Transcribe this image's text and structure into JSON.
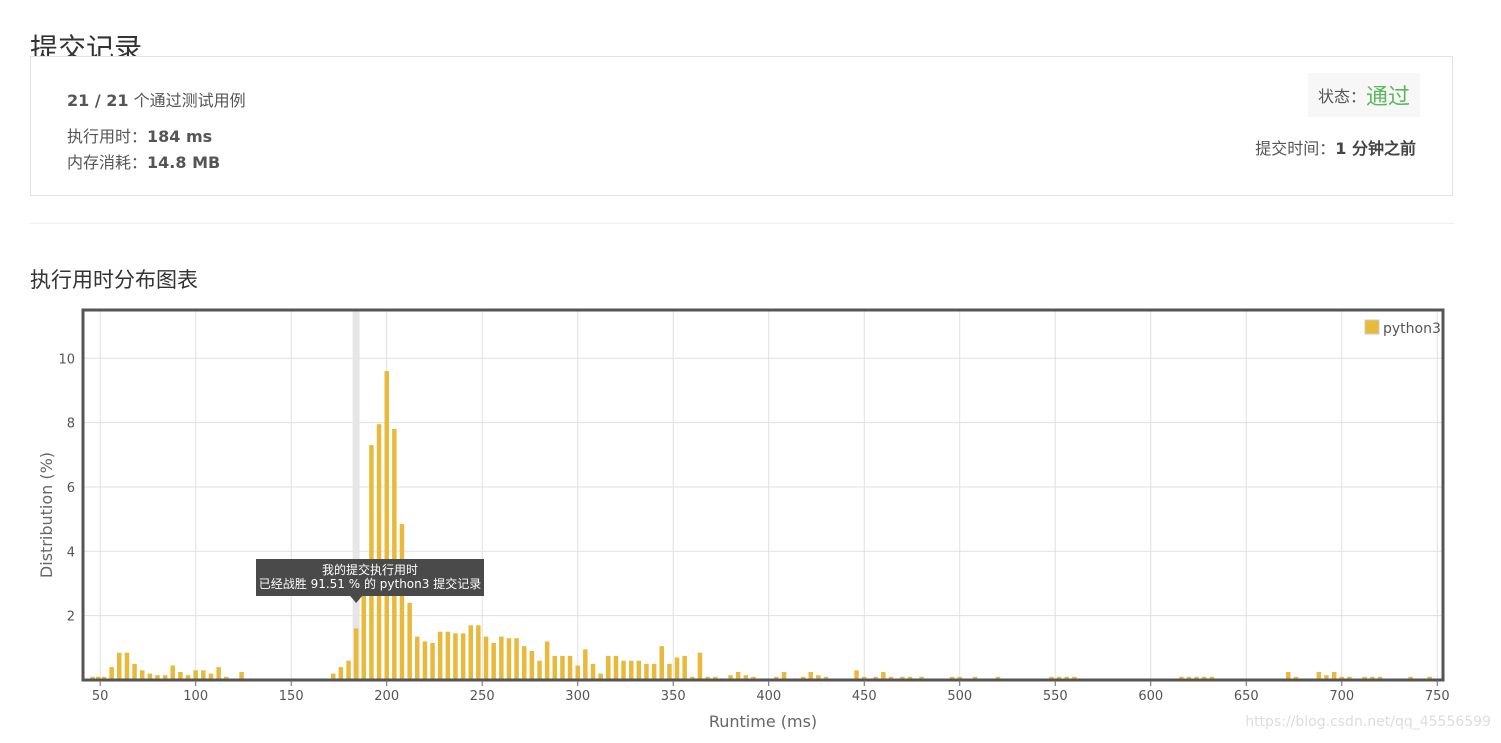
{
  "page": {
    "title": "提交记录"
  },
  "summary": {
    "tests_passed": "21 / 21",
    "tests_suffix": "个通过测试用例",
    "runtime_label": "执行用时：",
    "runtime_value": "184 ms",
    "memory_label": "内存消耗：",
    "memory_value": "14.8 MB",
    "status_label": "状态：",
    "status_value": "通过",
    "status_color": "#5cb85c",
    "submit_time_label": "提交时间：",
    "submit_time_value": "1 分钟之前"
  },
  "chart_section": {
    "title": "执行用时分布图表"
  },
  "chart_data": {
    "type": "bar",
    "xlabel": "Runtime (ms)",
    "ylabel": "Distribution (%)",
    "xlim": [
      41,
      753
    ],
    "ylim": [
      0,
      11.5
    ],
    "xticks": [
      50,
      100,
      150,
      200,
      250,
      300,
      350,
      400,
      450,
      500,
      550,
      600,
      650,
      700,
      750
    ],
    "yticks": [
      2,
      4,
      6,
      8,
      10
    ],
    "grid": true,
    "legend": {
      "position": "top-right"
    },
    "series": [
      {
        "name": "python3",
        "color": "#e8b93a",
        "points": [
          [
            46,
            0.1
          ],
          [
            49,
            0.1
          ],
          [
            52,
            0.1
          ],
          [
            56,
            0.4
          ],
          [
            60,
            0.85
          ],
          [
            64,
            0.85
          ],
          [
            68,
            0.5
          ],
          [
            72,
            0.3
          ],
          [
            76,
            0.2
          ],
          [
            80,
            0.15
          ],
          [
            84,
            0.15
          ],
          [
            88,
            0.45
          ],
          [
            92,
            0.25
          ],
          [
            96,
            0.15
          ],
          [
            100,
            0.3
          ],
          [
            104,
            0.3
          ],
          [
            108,
            0.2
          ],
          [
            112,
            0.4
          ],
          [
            116,
            0.1
          ],
          [
            124,
            0.25
          ],
          [
            172,
            0.2
          ],
          [
            176,
            0.4
          ],
          [
            180,
            0.6
          ],
          [
            184,
            1.6
          ],
          [
            188,
            3.5
          ],
          [
            192,
            7.3
          ],
          [
            196,
            7.95
          ],
          [
            200,
            9.6
          ],
          [
            204,
            7.8
          ],
          [
            208,
            4.85
          ],
          [
            212,
            2.4
          ],
          [
            216,
            1.35
          ],
          [
            220,
            1.2
          ],
          [
            224,
            1.15
          ],
          [
            228,
            1.5
          ],
          [
            232,
            1.5
          ],
          [
            236,
            1.45
          ],
          [
            240,
            1.45
          ],
          [
            244,
            1.7
          ],
          [
            248,
            1.7
          ],
          [
            252,
            1.35
          ],
          [
            256,
            1.15
          ],
          [
            260,
            1.35
          ],
          [
            264,
            1.3
          ],
          [
            268,
            1.3
          ],
          [
            272,
            1.05
          ],
          [
            276,
            0.9
          ],
          [
            280,
            0.6
          ],
          [
            284,
            1.2
          ],
          [
            288,
            0.75
          ],
          [
            292,
            0.75
          ],
          [
            296,
            0.75
          ],
          [
            300,
            0.45
          ],
          [
            304,
            0.95
          ],
          [
            308,
            0.5
          ],
          [
            312,
            0.2
          ],
          [
            316,
            0.75
          ],
          [
            320,
            0.75
          ],
          [
            324,
            0.6
          ],
          [
            328,
            0.6
          ],
          [
            332,
            0.6
          ],
          [
            336,
            0.5
          ],
          [
            340,
            0.5
          ],
          [
            344,
            1.05
          ],
          [
            348,
            0.5
          ],
          [
            352,
            0.7
          ],
          [
            356,
            0.75
          ],
          [
            360,
            0.1
          ],
          [
            364,
            0.85
          ],
          [
            368,
            0.1
          ],
          [
            372,
            0.1
          ],
          [
            376,
            0.05
          ],
          [
            380,
            0.15
          ],
          [
            384,
            0.25
          ],
          [
            388,
            0.15
          ],
          [
            392,
            0.1
          ],
          [
            404,
            0.1
          ],
          [
            408,
            0.25
          ],
          [
            418,
            0.1
          ],
          [
            422,
            0.25
          ],
          [
            426,
            0.15
          ],
          [
            430,
            0.1
          ],
          [
            446,
            0.3
          ],
          [
            450,
            0.1
          ],
          [
            456,
            0.1
          ],
          [
            460,
            0.25
          ],
          [
            464,
            0.1
          ],
          [
            470,
            0.1
          ],
          [
            474,
            0.1
          ],
          [
            480,
            0.1
          ],
          [
            496,
            0.1
          ],
          [
            500,
            0.1
          ],
          [
            508,
            0.1
          ],
          [
            520,
            0.1
          ],
          [
            548,
            0.1
          ],
          [
            552,
            0.1
          ],
          [
            556,
            0.1
          ],
          [
            560,
            0.1
          ],
          [
            616,
            0.1
          ],
          [
            620,
            0.1
          ],
          [
            624,
            0.1
          ],
          [
            628,
            0.1
          ],
          [
            632,
            0.1
          ],
          [
            672,
            0.25
          ],
          [
            676,
            0.1
          ],
          [
            688,
            0.25
          ],
          [
            692,
            0.15
          ],
          [
            696,
            0.25
          ],
          [
            700,
            0.1
          ],
          [
            704,
            0.1
          ],
          [
            712,
            0.1
          ],
          [
            716,
            0.1
          ],
          [
            720,
            0.1
          ],
          [
            736,
            0.1
          ],
          [
            746,
            0.1
          ]
        ]
      }
    ],
    "highlight": {
      "x": 184
    },
    "tooltip": {
      "line1": "我的提交执行用时",
      "line2": "已经战胜 91.51 % 的 python3 提交记录"
    }
  },
  "watermark": "https://blog.csdn.net/qq_45556599"
}
